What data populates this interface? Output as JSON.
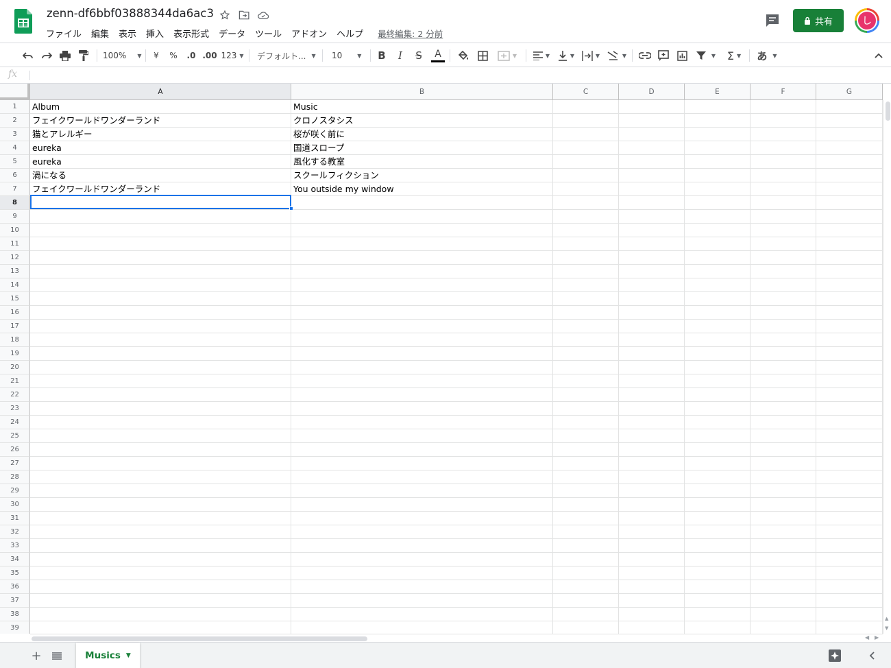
{
  "header": {
    "doc_title": "zenn-df6bbf03888344da6ac3",
    "menu": [
      "ファイル",
      "編集",
      "表示",
      "挿入",
      "表示形式",
      "データ",
      "ツール",
      "アドオン",
      "ヘルプ"
    ],
    "last_edit": "最終編集: 2 分前",
    "share_label": "共有",
    "avatar_letter": "し"
  },
  "toolbar": {
    "zoom": "100%",
    "currency": "¥",
    "percent": "%",
    "dec_decrease": ".0",
    "dec_increase": ".00",
    "more_formats": "123",
    "font": "デフォルト...",
    "font_size": "10",
    "bold": "B",
    "italic": "I",
    "strike": "S",
    "text_color": "A",
    "input_tools": "あ",
    "colors": {
      "text_color_bar": "#000000"
    }
  },
  "formula_bar": {
    "fx": "fx",
    "value": ""
  },
  "grid": {
    "columns": [
      "A",
      "B",
      "C",
      "D",
      "E",
      "F",
      "G"
    ],
    "row_count": 39,
    "selected_row": 8,
    "selected_column": "A",
    "rows": [
      [
        "Album",
        "Music"
      ],
      [
        "フェイクワールドワンダーランド",
        "クロノスタシス"
      ],
      [
        "猫とアレルギー",
        "桜が咲く前に"
      ],
      [
        "eureka",
        "国道スロープ"
      ],
      [
        "eureka",
        "風化する教室"
      ],
      [
        "渦になる",
        "スクールフィクション"
      ],
      [
        "フェイクワールドワンダーランド",
        "You outside my window"
      ]
    ]
  },
  "sheets": {
    "tabs": [
      {
        "label": "Musics",
        "active": true
      }
    ]
  },
  "colors": {
    "accent_green": "#188038",
    "selection_blue": "#1a73e8"
  }
}
